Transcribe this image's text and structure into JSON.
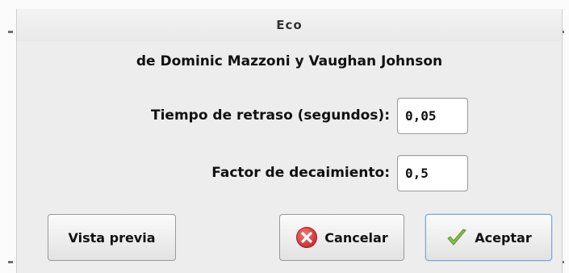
{
  "window": {
    "title": "Eco"
  },
  "credits": "de Dominic Mazzoni y Vaughan Johnson",
  "fields": {
    "delay": {
      "label": "Tiempo de retraso (segundos):",
      "value": "0,05"
    },
    "decay": {
      "label": "Factor de decaimiento:",
      "value": "0,5"
    }
  },
  "buttons": {
    "preview": "Vista previa",
    "cancel": "Cancelar",
    "ok": "Aceptar"
  },
  "icons": {
    "cancel": "close-circle-icon",
    "ok": "checkmark-icon"
  },
  "colors": {
    "cancel_icon": "#d93b3b",
    "ok_icon": "#7cb83a",
    "default_button_border": "#7fa6cf"
  }
}
